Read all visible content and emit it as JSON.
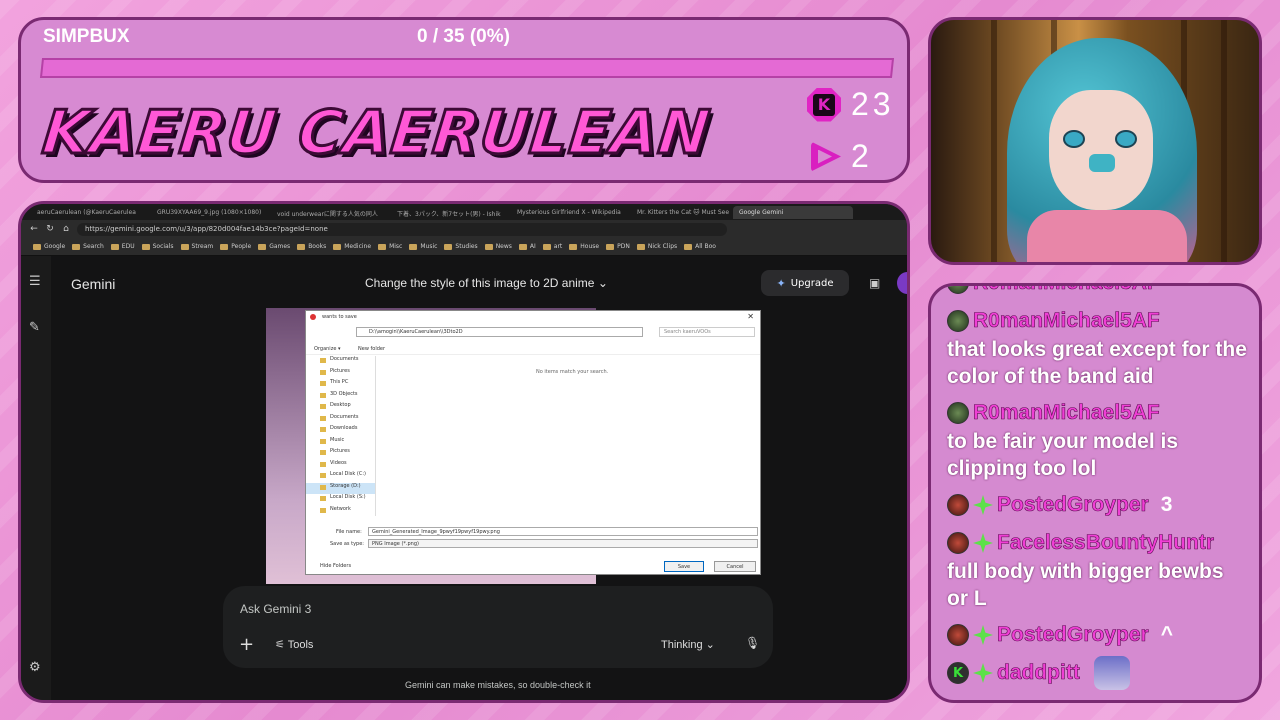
{
  "header": {
    "currency_label": "SIMPBUX",
    "progress_text": "0 / 35 (0%)",
    "progress_fraction": 0,
    "streamer_name": "KAERU CAERULEAN",
    "kick_badge_letter": "K",
    "kick_stat": "23",
    "play_stat": "2",
    "colors": {
      "accent": "#e024c4",
      "panel": "#d78ad2",
      "border": "#7a2a72"
    }
  },
  "chat": {
    "messages": [
      {
        "user": "R0manMichael5AF",
        "text": "that looks great except for the color of the band aid",
        "inline": ""
      },
      {
        "user": "R0manMichael5AF",
        "text": "to be fair your model is clipping too lol",
        "inline": ""
      },
      {
        "user": "PostedGroyper",
        "text": "",
        "inline": "3"
      },
      {
        "user": "FacelessBountyHuntr",
        "text": "full body with bigger bewbs or L",
        "inline": ""
      },
      {
        "user": "PostedGroyper",
        "text": "",
        "inline": "^"
      },
      {
        "user": "daddpitt",
        "text": "",
        "inline": ""
      }
    ]
  },
  "browser": {
    "tabs": [
      "aeruCaerulean (@KaeruCaerulea",
      "GRU39XYAA69_9.jpg (1080×1080)",
      "void underwearに関する人気の同人",
      "下着、3パック、新7セット(男) - Ishik",
      "Mysterious Girlfriend X - Wikipedia",
      "Mr. Kitters the Cat 🐱 Must See",
      "Google Gemini"
    ],
    "url": "https://gemini.google.com/u/3/app/820d004fae14b3ce?pageId=none",
    "bookmarks": [
      "Google",
      "Search",
      "EDU",
      "Socials",
      "Stream",
      "People",
      "Games",
      "Books",
      "Medicine",
      "Misc",
      "Music",
      "Studies",
      "News",
      "AI",
      "art",
      "House",
      "PDN",
      "Nick Clips",
      "All Boo"
    ]
  },
  "gemini": {
    "brand": "Gemini",
    "conversation_title": "Change the style of this image to 2D anime",
    "upgrade_label": "Upgrade",
    "ask_placeholder": "Ask Gemini 3",
    "tools_label": "Tools",
    "mode_label": "Thinking",
    "disclaimer": "Gemini can make mistakes, so double-check it"
  },
  "save_dialog": {
    "title": "wants to save",
    "path": "D:\\\\amogin\\\\KaeruCaerulean\\\\3Dto2D",
    "search_placeholder": "Search kaeruVOOs",
    "organize": "Organize ▾",
    "new_folder": "New folder",
    "empty_message": "No items match your search.",
    "tree": [
      "Documents",
      "Pictures",
      "This PC",
      "3D Objects",
      "Desktop",
      "Documents",
      "Downloads",
      "Music",
      "Pictures",
      "Videos",
      "Local Disk (C:)",
      "Storage (D:)",
      "Local Disk (S:)",
      "Network"
    ],
    "file_name_label": "File name:",
    "file_name": "Gemini_Generated_Image_9pwyf19pwyf19pwy.png",
    "save_type_label": "Save as type:",
    "save_type": "PNG Image (*.png)",
    "hide_folders": "Hide Folders",
    "save_button": "Save",
    "cancel_button": "Cancel"
  }
}
